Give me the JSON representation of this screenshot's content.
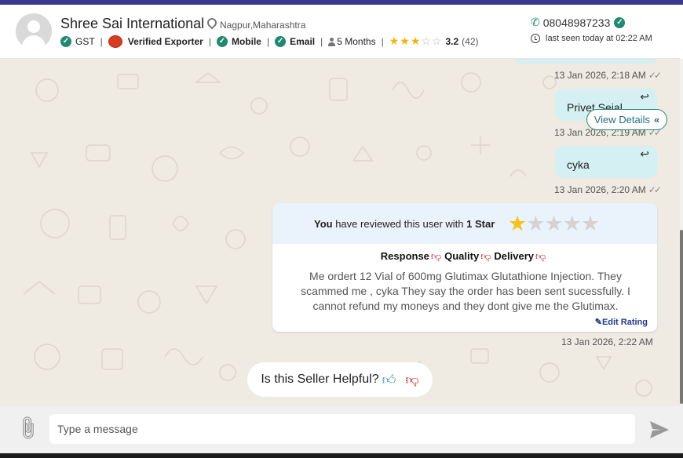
{
  "header": {
    "company_name": "Shree Sai International",
    "location": "Nagpur,Maharashtra",
    "badges": {
      "gst": "GST",
      "verified_exporter": "Verified Exporter",
      "mobile": "Mobile",
      "email": "Email",
      "membership": "5 Months"
    },
    "rating": "3.2",
    "rating_count": "(42)",
    "phone": "08048987233",
    "last_seen": "last seen today at 02:22 AM"
  },
  "chat": {
    "view_details_label": "View Details",
    "messages": [
      {
        "text": "",
        "timestamp": "13 Jan 2026, 2:18 AM"
      },
      {
        "text": "Privet Sejal",
        "timestamp": "13 Jan 2026, 2:19 AM"
      },
      {
        "text": "cyka",
        "timestamp": "13 Jan 2026, 2:20 AM"
      }
    ],
    "review": {
      "you": "You",
      "prefix": " have reviewed this user with ",
      "star_text": "1 Star",
      "stars_given": 1,
      "stars_total": 5,
      "criteria": [
        "Response",
        "Quality",
        "Delivery"
      ],
      "text": "Me ordert 12 Vial of 600mg Glutimax Glutathione Injection. They scammed me , cyka They say the order has been sent sucessfully. I cannot refund my moneys and they dont give me the Glutimax.",
      "edit_label": "Edit Rating",
      "timestamp": "13 Jan 2026, 2:22 AM"
    },
    "helpful_question": "Is this Seller Helpful?"
  },
  "input": {
    "placeholder": "Type a message"
  },
  "colors": {
    "accent": "#1f8a70",
    "bubble": "#d5f0f2",
    "chat_background": "#efeae2",
    "thumb_down": "#cc1111"
  }
}
